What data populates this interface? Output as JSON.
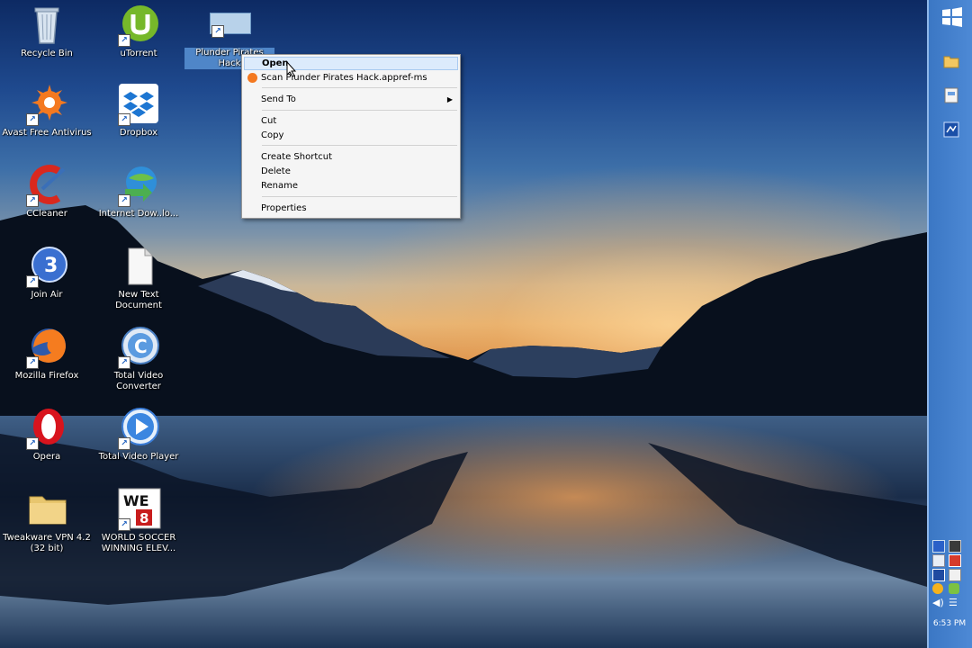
{
  "desktop_icons": [
    {
      "label": "Recycle Bin",
      "icon": "recycle-bin-icon"
    },
    {
      "label": "uTorrent",
      "icon": "utorrent-icon"
    },
    {
      "label": "Plunder Pirates Hack",
      "icon": "app-file-icon"
    },
    {
      "label": "Avast Free Antivirus",
      "icon": "avast-icon"
    },
    {
      "label": "Dropbox",
      "icon": "dropbox-icon"
    },
    {
      "label": "CCleaner",
      "icon": "ccleaner-icon"
    },
    {
      "label": "Internet Dow..lo...",
      "icon": "internet-download-manager-icon"
    },
    {
      "label": "Join Air",
      "icon": "join-air-icon"
    },
    {
      "label": "New Text Document",
      "icon": "text-document-icon"
    },
    {
      "label": "Mozilla Firefox",
      "icon": "firefox-icon"
    },
    {
      "label": "Total Video Converter",
      "icon": "total-video-converter-icon"
    },
    {
      "label": "Opera",
      "icon": "opera-icon"
    },
    {
      "label": "Total Video Player",
      "icon": "total-video-player-icon"
    },
    {
      "label": "Tweakware VPN 4.2 (32 bit)",
      "icon": "folder-icon"
    },
    {
      "label": "WORLD SOCCER WINNING ELEV...",
      "icon": "winning-eleven-icon"
    }
  ],
  "context_menu": {
    "open": "Open",
    "scan": "Scan Plunder Pirates Hack.appref-ms",
    "send_to": "Send To",
    "cut": "Cut",
    "copy": "Copy",
    "create_shortcut": "Create Shortcut",
    "delete": "Delete",
    "rename": "Rename",
    "properties": "Properties"
  },
  "taskbar": {
    "clock": "6:53 PM",
    "icons": [
      "windows-logo-icon",
      "file-explorer-icon",
      "document-icon",
      "app-icon"
    ]
  },
  "colors": {
    "taskbar": "#4a86d3",
    "menu_highlight": "#dcebfc"
  }
}
